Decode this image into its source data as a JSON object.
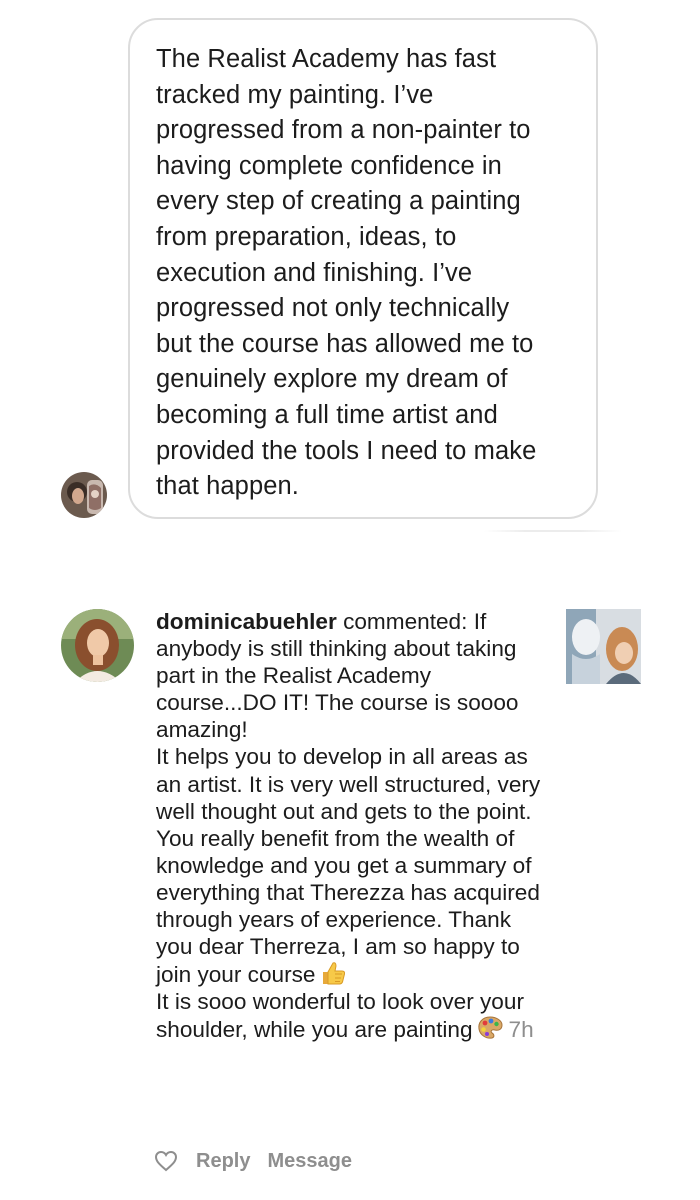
{
  "message": {
    "text": "The Realist Academy has fast\ntracked my painting. I’ve\nprogressed from a non-painter to\nhaving complete confidence in\nevery step of creating a painting\nfrom preparation, ideas, to\nexecution and finishing.  I’ve\nprogressed not only technically\nbut the course has allowed me to\ngenuinely explore my dream of\nbecoming a full time artist and\nprovided the tools I need to make\nthat happen."
  },
  "comment": {
    "username": "dominicabuehler",
    "action": " commented: ",
    "paragraph1": "If anybody is still thinking about taking part in the Realist Academy course...DO IT! The course is soooo amazing!",
    "paragraph2": "It helps you to develop in all areas as an artist. It is very well structured, very well thought out and gets to the point. You really benefit from the wealth of knowledge and you get a summary of everything that Therezza has acquired through years of experience. Thank you dear Therreza, I am so happy to join your course",
    "paragraph3": "It is sooo wonderful to look over your shoulder, while you are painting",
    "timestamp": "7h",
    "icons": {
      "emoji1": "thumbs-up-icon",
      "emoji2": "artist-palette-icon"
    }
  },
  "actions": {
    "like_icon": "heart-outline-icon",
    "reply_label": "Reply",
    "message_label": "Message"
  },
  "colors": {
    "bubble_border": "#dcdcdc",
    "muted_text": "#8e8e8e",
    "body_text": "#1c1c1c"
  }
}
